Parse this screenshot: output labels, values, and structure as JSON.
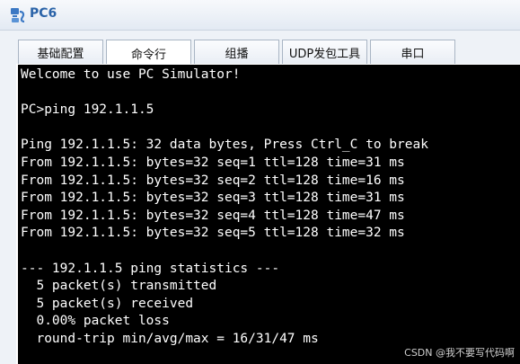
{
  "window": {
    "title": "PC6"
  },
  "tabs": [
    {
      "label": "基础配置",
      "active": false
    },
    {
      "label": "命令行",
      "active": true
    },
    {
      "label": "组播",
      "active": false
    },
    {
      "label": "UDP发包工具",
      "active": false
    },
    {
      "label": "串口",
      "active": false
    }
  ],
  "terminal": {
    "lines": [
      "Welcome to use PC Simulator!",
      "",
      "PC>ping 192.1.1.5",
      "",
      "Ping 192.1.1.5: 32 data bytes, Press Ctrl_C to break",
      "From 192.1.1.5: bytes=32 seq=1 ttl=128 time=31 ms",
      "From 192.1.1.5: bytes=32 seq=2 ttl=128 time=16 ms",
      "From 192.1.1.5: bytes=32 seq=3 ttl=128 time=31 ms",
      "From 192.1.1.5: bytes=32 seq=4 ttl=128 time=47 ms",
      "From 192.1.1.5: bytes=32 seq=5 ttl=128 time=32 ms",
      "",
      "--- 192.1.1.5 ping statistics ---",
      "  5 packet(s) transmitted",
      "  5 packet(s) received",
      "  0.00% packet loss",
      "  round-trip min/avg/max = 16/31/47 ms"
    ]
  },
  "watermark": "CSDN @我不要写代码啊"
}
